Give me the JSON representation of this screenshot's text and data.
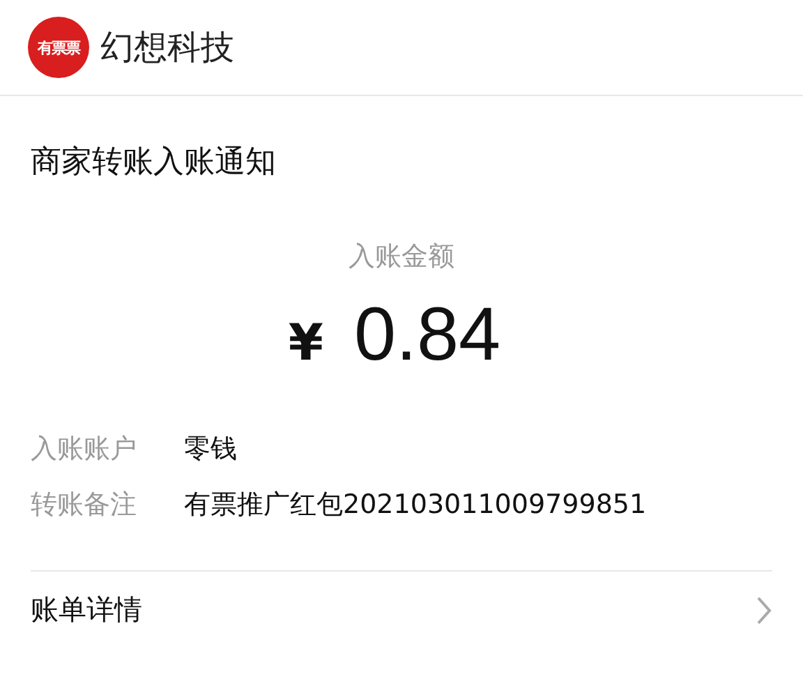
{
  "header": {
    "logo_text": "有票票",
    "title": "幻想科技"
  },
  "notice": {
    "title": "商家转账入账通知",
    "amount_label": "入账金额",
    "currency": "¥",
    "amount": "0.84",
    "fields": [
      {
        "label": "入账账户",
        "value": "零钱"
      },
      {
        "label": "转账备注",
        "value": "有票推广红包202103011009799851"
      }
    ]
  },
  "footer": {
    "link": "账单详情"
  }
}
